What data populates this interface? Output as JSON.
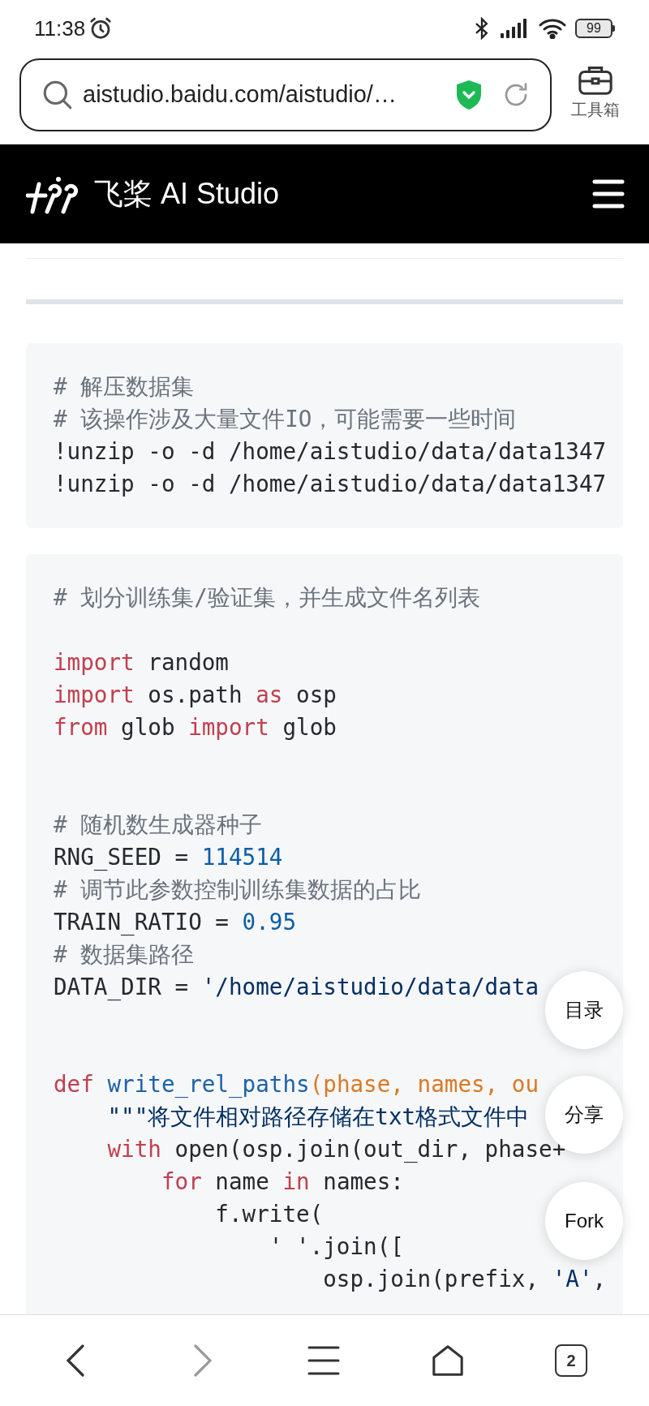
{
  "status_bar": {
    "time": "11:38",
    "battery": "99"
  },
  "address_bar": {
    "url": "aistudio.baidu.com/aistudio/…",
    "toolbox_label": "工具箱"
  },
  "site_header": {
    "brand": "飞桨 AI Studio"
  },
  "code_cells": [
    {
      "lines": [
        {
          "kind": "code",
          "tokens": [
            {
              "kind": "comment",
              "text": "# 解压数据集"
            }
          ]
        },
        {
          "kind": "code",
          "tokens": [
            {
              "kind": "comment",
              "text": "# 该操作涉及大量文件IO，可能需要一些时间"
            }
          ]
        },
        {
          "kind": "code",
          "tokens": [
            {
              "kind": "plain",
              "text": "!unzip -o -d /home/aistudio/data/data1347"
            }
          ]
        },
        {
          "kind": "code",
          "tokens": [
            {
              "kind": "plain",
              "text": "!unzip -o -d /home/aistudio/data/data1347"
            }
          ]
        }
      ]
    },
    {
      "lines": [
        {
          "kind": "code",
          "tokens": [
            {
              "kind": "comment",
              "text": "# 划分训练集/验证集，并生成文件名列表"
            }
          ]
        },
        {
          "kind": "blank"
        },
        {
          "kind": "code",
          "tokens": [
            {
              "kind": "keyword",
              "text": "import"
            },
            {
              "kind": "plain",
              "text": " random"
            }
          ]
        },
        {
          "kind": "code",
          "tokens": [
            {
              "kind": "keyword",
              "text": "import"
            },
            {
              "kind": "plain",
              "text": " os.path "
            },
            {
              "kind": "keyword",
              "text": "as"
            },
            {
              "kind": "plain",
              "text": " osp"
            }
          ]
        },
        {
          "kind": "code",
          "tokens": [
            {
              "kind": "keyword",
              "text": "from"
            },
            {
              "kind": "plain",
              "text": " glob "
            },
            {
              "kind": "keyword",
              "text": "import"
            },
            {
              "kind": "plain",
              "text": " glob"
            }
          ]
        },
        {
          "kind": "blank"
        },
        {
          "kind": "blank"
        },
        {
          "kind": "code",
          "tokens": [
            {
              "kind": "comment",
              "text": "# 随机数生成器种子"
            }
          ]
        },
        {
          "kind": "code",
          "tokens": [
            {
              "kind": "plain",
              "text": "RNG_SEED = "
            },
            {
              "kind": "number",
              "text": "114514"
            }
          ]
        },
        {
          "kind": "code",
          "tokens": [
            {
              "kind": "comment",
              "text": "# 调节此参数控制训练集数据的占比"
            }
          ]
        },
        {
          "kind": "code",
          "tokens": [
            {
              "kind": "plain",
              "text": "TRAIN_RATIO = "
            },
            {
              "kind": "number",
              "text": "0.95"
            }
          ]
        },
        {
          "kind": "code",
          "tokens": [
            {
              "kind": "comment",
              "text": "# 数据集路径"
            }
          ]
        },
        {
          "kind": "code",
          "tokens": [
            {
              "kind": "plain",
              "text": "DATA_DIR = "
            },
            {
              "kind": "string",
              "text": "'/home/aistudio/data/data"
            }
          ]
        },
        {
          "kind": "blank"
        },
        {
          "kind": "blank"
        },
        {
          "kind": "code",
          "tokens": [
            {
              "kind": "keyword",
              "text": "def"
            },
            {
              "kind": "function",
              "text": " write_rel_paths"
            },
            {
              "kind": "param",
              "text": "(phase, names, ou"
            }
          ]
        },
        {
          "kind": "code",
          "tokens": [
            {
              "kind": "string",
              "text": "    \"\"\"将文件相对路径存储在txt格式文件中"
            }
          ]
        },
        {
          "kind": "code",
          "tokens": [
            {
              "kind": "keyword",
              "text": "    with"
            },
            {
              "kind": "plain",
              "text": " open(osp.join(out_dir, phase+"
            }
          ]
        },
        {
          "kind": "code",
          "tokens": [
            {
              "kind": "keyword",
              "text": "        for"
            },
            {
              "kind": "plain",
              "text": " name "
            },
            {
              "kind": "keyword",
              "text": "in"
            },
            {
              "kind": "plain",
              "text": " names:"
            }
          ]
        },
        {
          "kind": "code",
          "tokens": [
            {
              "kind": "plain",
              "text": "            f.write("
            }
          ]
        },
        {
          "kind": "code",
          "tokens": [
            {
              "kind": "plain",
              "text": "                ' '.join(["
            }
          ]
        },
        {
          "kind": "code",
          "tokens": [
            {
              "kind": "plain",
              "text": "                    osp.join(prefix, "
            },
            {
              "kind": "string",
              "text": "'A'"
            },
            {
              "kind": "plain",
              "text": ","
            }
          ]
        }
      ]
    }
  ],
  "floating_buttons": [
    "目录",
    "分享",
    "Fork"
  ],
  "bottom_nav": {
    "tab_count": "2"
  }
}
